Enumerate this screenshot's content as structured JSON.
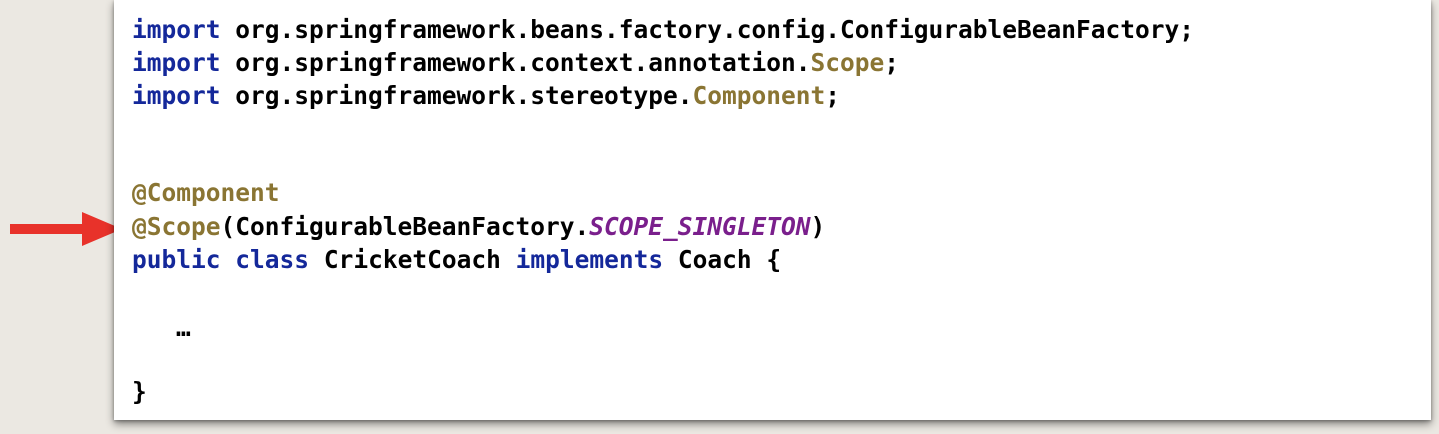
{
  "code": {
    "line1": {
      "keyword": "import",
      "text": " org.springframework.beans.factory.config.ConfigurableBeanFactory;"
    },
    "line2": {
      "keyword": "import",
      "text": " org.springframework.context.annotation.",
      "type": "Scope",
      "end": ";"
    },
    "line3": {
      "keyword": "import",
      "text": " org.springframework.stereotype.",
      "type": "Component",
      "end": ";"
    },
    "line4": {
      "annotation": "@Component"
    },
    "line5": {
      "annotation": "@Scope",
      "open": "(ConfigurableBeanFactory.",
      "constant": "SCOPE_SINGLETON",
      "close": ")"
    },
    "line6": {
      "kw1": "public",
      "kw2": "class",
      "name": "CricketCoach",
      "kw3": "implements",
      "iface": "Coach",
      "brace": "{"
    },
    "line7": {
      "ellipsis": "…"
    },
    "line8": {
      "brace": "}"
    }
  },
  "colors": {
    "keyword": "#14289a",
    "annotation": "#8a7533",
    "constant": "#7a1f8c",
    "arrow": "#e8322a",
    "background": "#ebe8e2"
  },
  "icons": {
    "pointer": "right-arrow-icon"
  }
}
